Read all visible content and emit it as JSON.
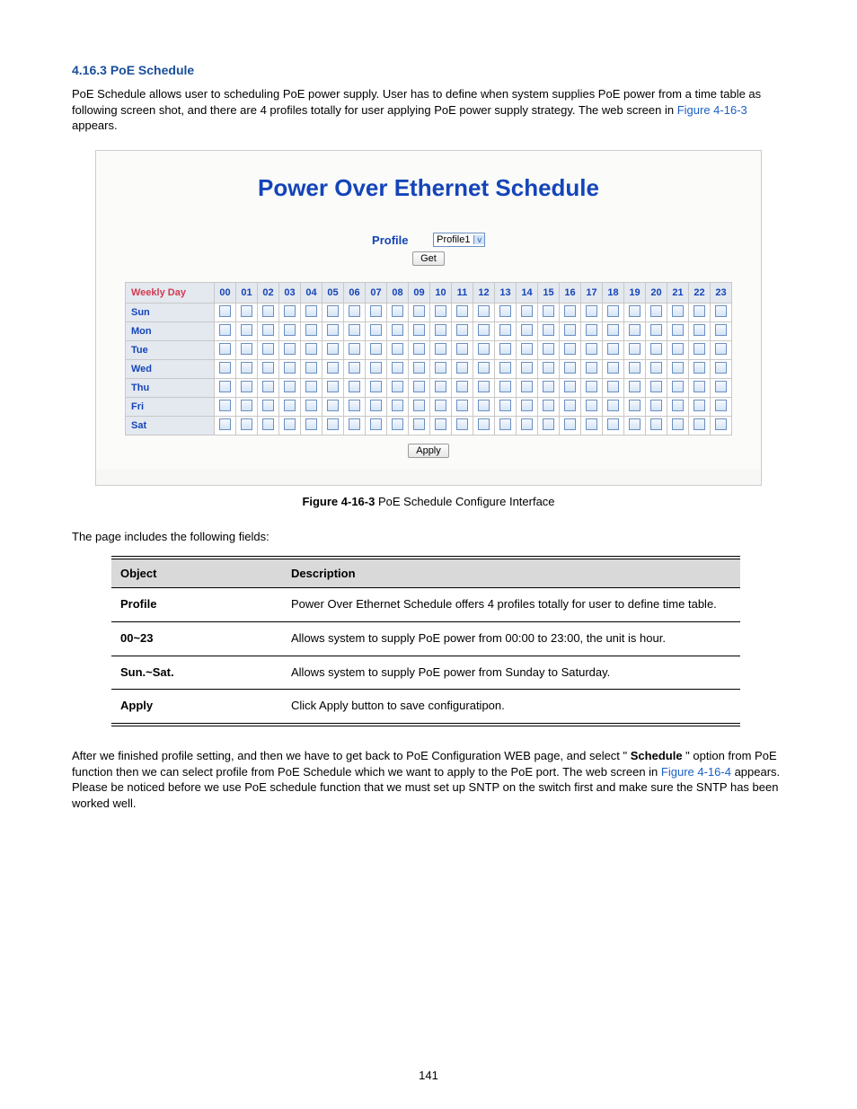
{
  "section_title": "4.16.3 PoE Schedule",
  "intro_1": "PoE Schedule allows user to scheduling PoE power supply. User has to define when system supplies PoE power from a time table as following screen shot, and there are 4 profiles totally for user applying PoE power supply strategy. The web screen in ",
  "figref1": "Figure 4-16-3",
  "intro_2": " appears.",
  "screenshot": {
    "title": "Power Over Ethernet Schedule",
    "profile_label": "Profile",
    "profile_selected": "Profile1",
    "get_btn": "Get",
    "day_header": "Weekly Day",
    "hours": [
      "00",
      "01",
      "02",
      "03",
      "04",
      "05",
      "06",
      "07",
      "08",
      "09",
      "10",
      "11",
      "12",
      "13",
      "14",
      "15",
      "16",
      "17",
      "18",
      "19",
      "20",
      "21",
      "22",
      "23"
    ],
    "days": [
      "Sun",
      "Mon",
      "Tue",
      "Wed",
      "Thu",
      "Fri",
      "Sat"
    ],
    "apply_btn": "Apply"
  },
  "figcap_label": "Figure 4-16-3",
  "figcap_text": " PoE Schedule Configure Interface",
  "fields_intro": "The page includes the following fields:",
  "fields": {
    "head_obj": "Object",
    "head_desc": "Description",
    "rows": [
      {
        "obj": "Profile",
        "desc": "Power Over Ethernet Schedule offers 4 profiles totally for user to define time table."
      },
      {
        "obj": "00~23",
        "desc": "Allows system to supply PoE power from 00:00 to 23:00, the unit is hour."
      },
      {
        "obj": "Sun.~Sat.",
        "desc": "Allows system to supply PoE power from Sunday to Saturday."
      },
      {
        "obj": "Apply",
        "desc": "Click Apply button to save configuratipon."
      }
    ]
  },
  "after_1a": "After we finished profile setting, and then we have to get back to PoE Configuration WEB page, and select \" ",
  "after_bold": "Schedule",
  "after_1b": " \" option from PoE function then we can select profile from PoE Schedule which we want to apply to the PoE port. The web screen in ",
  "figref2": "Figure 4-16-4",
  "after_1c": " appears.",
  "after_2": "Please be noticed before we use PoE schedule function that we must set up SNTP on the switch first and make sure the SNTP has been worked well.",
  "page_number": "141"
}
